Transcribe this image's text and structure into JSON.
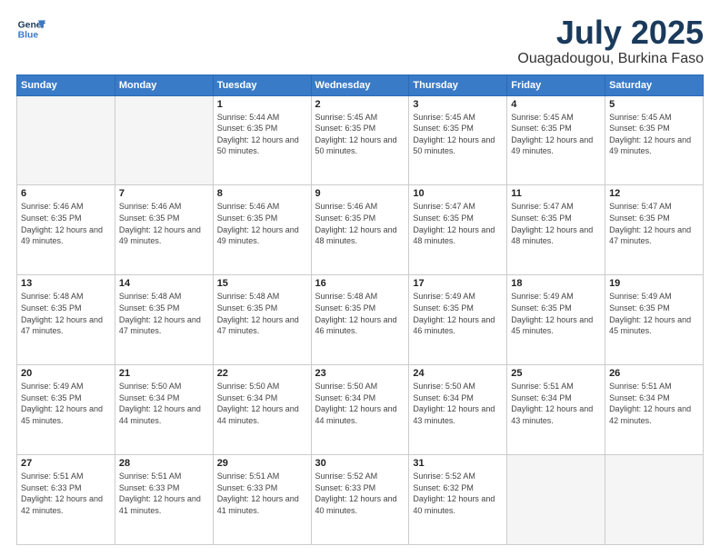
{
  "logo": {
    "line1": "General",
    "line2": "Blue"
  },
  "title": "July 2025",
  "location": "Ouagadougou, Burkina Faso",
  "days_of_week": [
    "Sunday",
    "Monday",
    "Tuesday",
    "Wednesday",
    "Thursday",
    "Friday",
    "Saturday"
  ],
  "weeks": [
    [
      {
        "day": "",
        "info": ""
      },
      {
        "day": "",
        "info": ""
      },
      {
        "day": "1",
        "info": "Sunrise: 5:44 AM\nSunset: 6:35 PM\nDaylight: 12 hours and 50 minutes."
      },
      {
        "day": "2",
        "info": "Sunrise: 5:45 AM\nSunset: 6:35 PM\nDaylight: 12 hours and 50 minutes."
      },
      {
        "day": "3",
        "info": "Sunrise: 5:45 AM\nSunset: 6:35 PM\nDaylight: 12 hours and 50 minutes."
      },
      {
        "day": "4",
        "info": "Sunrise: 5:45 AM\nSunset: 6:35 PM\nDaylight: 12 hours and 49 minutes."
      },
      {
        "day": "5",
        "info": "Sunrise: 5:45 AM\nSunset: 6:35 PM\nDaylight: 12 hours and 49 minutes."
      }
    ],
    [
      {
        "day": "6",
        "info": "Sunrise: 5:46 AM\nSunset: 6:35 PM\nDaylight: 12 hours and 49 minutes."
      },
      {
        "day": "7",
        "info": "Sunrise: 5:46 AM\nSunset: 6:35 PM\nDaylight: 12 hours and 49 minutes."
      },
      {
        "day": "8",
        "info": "Sunrise: 5:46 AM\nSunset: 6:35 PM\nDaylight: 12 hours and 49 minutes."
      },
      {
        "day": "9",
        "info": "Sunrise: 5:46 AM\nSunset: 6:35 PM\nDaylight: 12 hours and 48 minutes."
      },
      {
        "day": "10",
        "info": "Sunrise: 5:47 AM\nSunset: 6:35 PM\nDaylight: 12 hours and 48 minutes."
      },
      {
        "day": "11",
        "info": "Sunrise: 5:47 AM\nSunset: 6:35 PM\nDaylight: 12 hours and 48 minutes."
      },
      {
        "day": "12",
        "info": "Sunrise: 5:47 AM\nSunset: 6:35 PM\nDaylight: 12 hours and 47 minutes."
      }
    ],
    [
      {
        "day": "13",
        "info": "Sunrise: 5:48 AM\nSunset: 6:35 PM\nDaylight: 12 hours and 47 minutes."
      },
      {
        "day": "14",
        "info": "Sunrise: 5:48 AM\nSunset: 6:35 PM\nDaylight: 12 hours and 47 minutes."
      },
      {
        "day": "15",
        "info": "Sunrise: 5:48 AM\nSunset: 6:35 PM\nDaylight: 12 hours and 47 minutes."
      },
      {
        "day": "16",
        "info": "Sunrise: 5:48 AM\nSunset: 6:35 PM\nDaylight: 12 hours and 46 minutes."
      },
      {
        "day": "17",
        "info": "Sunrise: 5:49 AM\nSunset: 6:35 PM\nDaylight: 12 hours and 46 minutes."
      },
      {
        "day": "18",
        "info": "Sunrise: 5:49 AM\nSunset: 6:35 PM\nDaylight: 12 hours and 45 minutes."
      },
      {
        "day": "19",
        "info": "Sunrise: 5:49 AM\nSunset: 6:35 PM\nDaylight: 12 hours and 45 minutes."
      }
    ],
    [
      {
        "day": "20",
        "info": "Sunrise: 5:49 AM\nSunset: 6:35 PM\nDaylight: 12 hours and 45 minutes."
      },
      {
        "day": "21",
        "info": "Sunrise: 5:50 AM\nSunset: 6:34 PM\nDaylight: 12 hours and 44 minutes."
      },
      {
        "day": "22",
        "info": "Sunrise: 5:50 AM\nSunset: 6:34 PM\nDaylight: 12 hours and 44 minutes."
      },
      {
        "day": "23",
        "info": "Sunrise: 5:50 AM\nSunset: 6:34 PM\nDaylight: 12 hours and 44 minutes."
      },
      {
        "day": "24",
        "info": "Sunrise: 5:50 AM\nSunset: 6:34 PM\nDaylight: 12 hours and 43 minutes."
      },
      {
        "day": "25",
        "info": "Sunrise: 5:51 AM\nSunset: 6:34 PM\nDaylight: 12 hours and 43 minutes."
      },
      {
        "day": "26",
        "info": "Sunrise: 5:51 AM\nSunset: 6:34 PM\nDaylight: 12 hours and 42 minutes."
      }
    ],
    [
      {
        "day": "27",
        "info": "Sunrise: 5:51 AM\nSunset: 6:33 PM\nDaylight: 12 hours and 42 minutes."
      },
      {
        "day": "28",
        "info": "Sunrise: 5:51 AM\nSunset: 6:33 PM\nDaylight: 12 hours and 41 minutes."
      },
      {
        "day": "29",
        "info": "Sunrise: 5:51 AM\nSunset: 6:33 PM\nDaylight: 12 hours and 41 minutes."
      },
      {
        "day": "30",
        "info": "Sunrise: 5:52 AM\nSunset: 6:33 PM\nDaylight: 12 hours and 40 minutes."
      },
      {
        "day": "31",
        "info": "Sunrise: 5:52 AM\nSunset: 6:32 PM\nDaylight: 12 hours and 40 minutes."
      },
      {
        "day": "",
        "info": ""
      },
      {
        "day": "",
        "info": ""
      }
    ]
  ]
}
